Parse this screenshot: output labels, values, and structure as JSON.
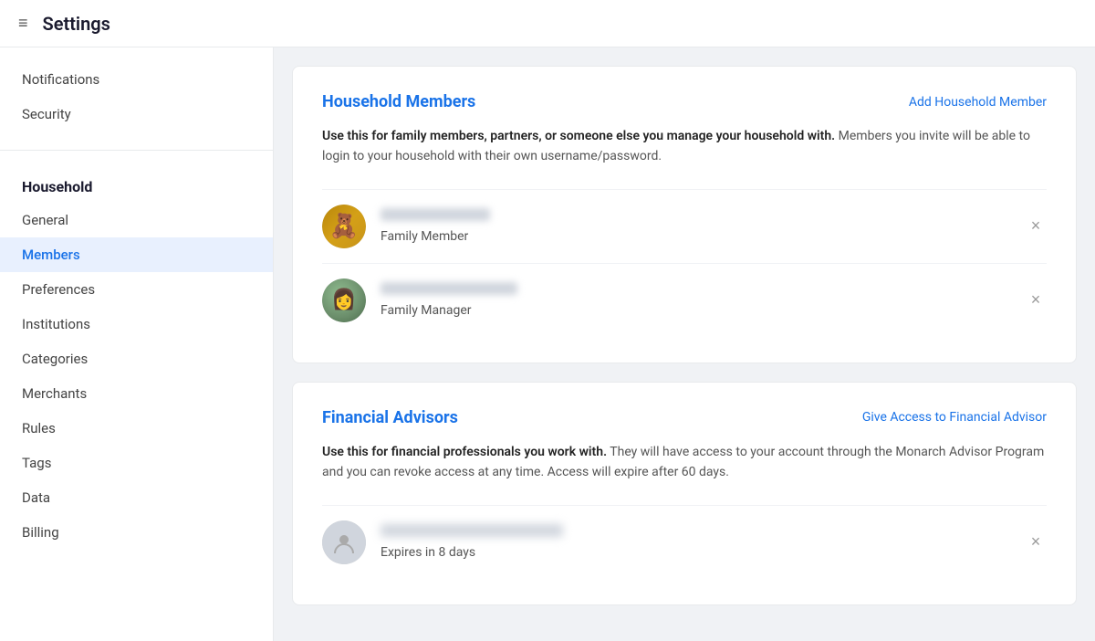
{
  "header": {
    "title": "Settings",
    "menu_icon": "≡"
  },
  "sidebar": {
    "top_section": {
      "items": [
        {
          "id": "notifications",
          "label": "Notifications",
          "active": false
        },
        {
          "id": "security",
          "label": "Security",
          "active": false
        }
      ]
    },
    "household_section": {
      "group_label": "Household",
      "items": [
        {
          "id": "general",
          "label": "General",
          "active": false
        },
        {
          "id": "members",
          "label": "Members",
          "active": true
        },
        {
          "id": "preferences",
          "label": "Preferences",
          "active": false
        },
        {
          "id": "institutions",
          "label": "Institutions",
          "active": false
        },
        {
          "id": "categories",
          "label": "Categories",
          "active": false
        },
        {
          "id": "merchants",
          "label": "Merchants",
          "active": false
        },
        {
          "id": "rules",
          "label": "Rules",
          "active": false
        },
        {
          "id": "tags",
          "label": "Tags",
          "active": false
        },
        {
          "id": "data",
          "label": "Data",
          "active": false
        },
        {
          "id": "billing",
          "label": "Billing",
          "active": false
        }
      ]
    }
  },
  "household_members_card": {
    "title": "Household Members",
    "action_label": "Add Household Member",
    "description_bold": "Use this for family members, partners, or someone else you manage your household with.",
    "description_rest": " Members you invite will be able to login to your household with their own username/password.",
    "members": [
      {
        "id": "member-1",
        "avatar_type": "bear",
        "avatar_emoji": "🧸",
        "role": "Family Member"
      },
      {
        "id": "member-2",
        "avatar_type": "woman",
        "avatar_emoji": "👩",
        "role": "Family Manager"
      }
    ]
  },
  "financial_advisors_card": {
    "title": "Financial Advisors",
    "action_label": "Give Access to Financial Advisor",
    "description_bold": "Use this for financial professionals you work with.",
    "description_rest": " They will have access to your account through the Monarch Advisor Program and you can revoke access at any time. Access will expire after 60 days.",
    "advisors": [
      {
        "id": "advisor-1",
        "avatar_type": "generic",
        "expires_text": "Expires in 8 days"
      }
    ]
  },
  "icons": {
    "close": "×",
    "menu": "≡",
    "person": "👤"
  }
}
